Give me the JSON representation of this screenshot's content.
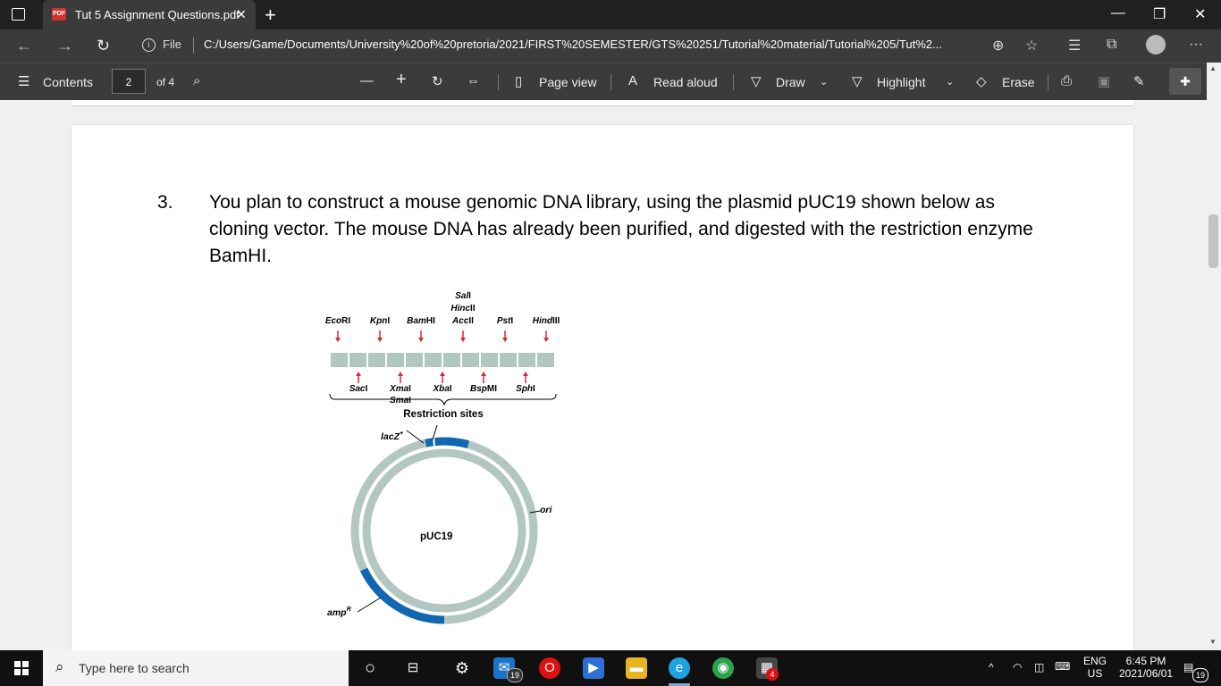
{
  "tab": {
    "title": "Tut 5 Assignment Questions.pdf",
    "file_badge": "PDF"
  },
  "address": {
    "scheme_label": "File",
    "url": "C:/Users/Game/Documents/University%20of%20pretoria/2021/FIRST%20SEMESTER/GTS%20251/Tutorial%20material/Tutorial%205/Tut%2..."
  },
  "toolbar": {
    "contents": "Contents",
    "page_number": "2",
    "page_total": "of 4",
    "page_view": "Page view",
    "read_aloud": "Read aloud",
    "draw": "Draw",
    "highlight": "Highlight",
    "erase": "Erase"
  },
  "document": {
    "question_number": "3.",
    "question_text": "You plan to construct a mouse genomic DNA library, using the plasmid pUC19 shown below as cloning vector. The mouse DNA has already been purified, and digested with the restriction enzyme BamHI."
  },
  "figure": {
    "sites_top": [
      {
        "prefix": "Eco",
        "suffix": "RI"
      },
      {
        "prefix": "Kpn",
        "suffix": "I"
      },
      {
        "prefix": "Bam",
        "suffix": "HI"
      },
      {
        "prefix": "Acc",
        "suffix": "II"
      },
      {
        "prefix": "Pst",
        "suffix": "I"
      },
      {
        "prefix": "Hind",
        "suffix": "III"
      }
    ],
    "acc_stack": [
      {
        "prefix": "Sal",
        "suffix": "I"
      },
      {
        "prefix": "Hinc",
        "suffix": "II"
      }
    ],
    "sites_bottom": [
      {
        "prefix": "Sac",
        "suffix": "I"
      },
      {
        "prefix": "Xma",
        "suffix": "I"
      },
      {
        "prefix": "Xba",
        "suffix": "I"
      },
      {
        "prefix": "Bsp",
        "suffix": "MI"
      },
      {
        "prefix": "Sph",
        "suffix": "I"
      }
    ],
    "sma_label": {
      "prefix": "Sma",
      "suffix": "I"
    },
    "restriction_sites": "Restriction sites",
    "lacz": "lacZ",
    "lacz_sup": "+",
    "plasmid": "pUC19",
    "ori": "ori",
    "amp": "amp",
    "amp_sup": "R",
    "colors": {
      "ring": "#b2c7c1",
      "gene": "#1167b1",
      "arrow": "#d52b2b"
    }
  },
  "taskbar": {
    "search_placeholder": "Type here to search",
    "mail_badge": "19",
    "store_badge": "4",
    "lang_top": "ENG",
    "lang_bottom": "US",
    "time": "6:45 PM",
    "date": "2021/06/01",
    "notif_badge": "19"
  }
}
